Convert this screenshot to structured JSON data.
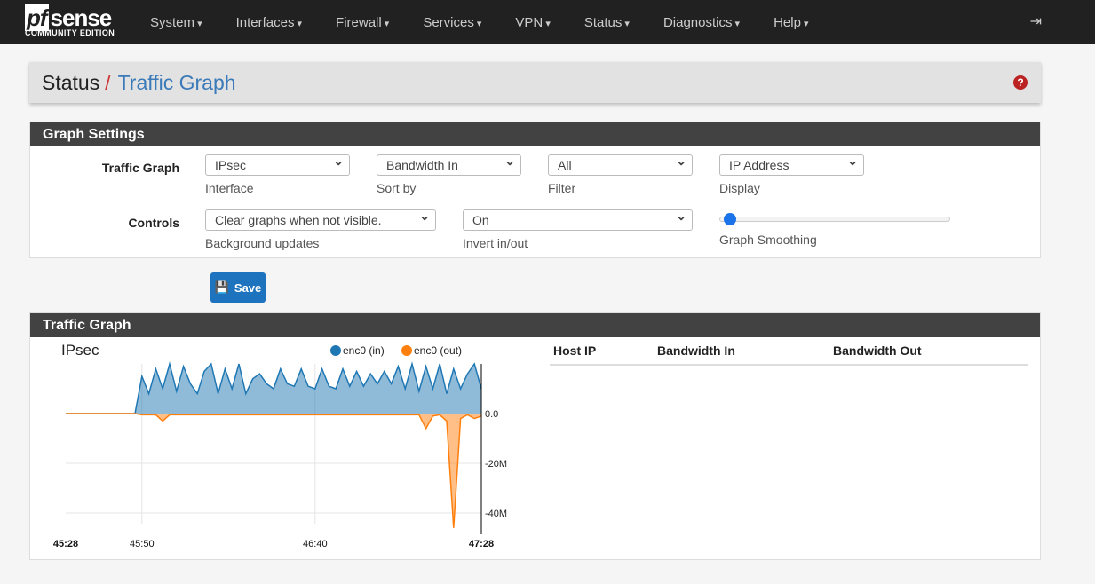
{
  "nav": {
    "logo_main": "pfsense",
    "logo_pf": "pf",
    "logo_rest": "sense",
    "logo_sub": "COMMUNITY EDITION",
    "items": [
      "System",
      "Interfaces",
      "Firewall",
      "Services",
      "VPN",
      "Status",
      "Diagnostics",
      "Help"
    ],
    "logout_icon": "sign-out-icon"
  },
  "breadcrumb": {
    "parent": "Status",
    "sep": "/",
    "current": "Traffic Graph",
    "help_icon": "question-circle-icon"
  },
  "settings": {
    "title": "Graph Settings",
    "row1": {
      "label": "Traffic Graph",
      "fields": [
        {
          "value": "IPsec",
          "hint": "Interface"
        },
        {
          "value": "Bandwidth In",
          "hint": "Sort by"
        },
        {
          "value": "All",
          "hint": "Filter"
        },
        {
          "value": "IP Address",
          "hint": "Display"
        }
      ]
    },
    "row2": {
      "label": "Controls",
      "fields": [
        {
          "value": "Clear graphs when not visible.",
          "hint": "Background updates"
        },
        {
          "value": "On",
          "hint": "Invert in/out"
        }
      ],
      "smoothing_hint": "Graph Smoothing",
      "smoothing_value": 0
    }
  },
  "save_label": "Save",
  "graph": {
    "title": "Traffic Graph",
    "table_headers": [
      "Host IP",
      "Bandwidth In",
      "Bandwidth Out"
    ]
  },
  "chart_data": {
    "type": "area",
    "title": "IPsec",
    "colors": {
      "in": "#1f77b4",
      "out": "#ff7f0e"
    },
    "xticks": [
      "45:28",
      "45:50",
      "46:40",
      "47:28"
    ],
    "xtick_seconds": [
      0,
      22,
      72,
      120
    ],
    "yticks": [
      "0.0",
      "-20M",
      "-40M"
    ],
    "ytick_values": [
      0,
      -20,
      -40
    ],
    "ylim": [
      -48,
      22
    ],
    "yunit": "M",
    "x_seconds": [
      0,
      2,
      4,
      6,
      8,
      10,
      12,
      14,
      16,
      18,
      20,
      22,
      24,
      26,
      28,
      30,
      32,
      34,
      36,
      38,
      40,
      42,
      44,
      46,
      48,
      50,
      52,
      54,
      56,
      58,
      60,
      62,
      64,
      66,
      68,
      70,
      72,
      74,
      76,
      78,
      80,
      82,
      84,
      86,
      88,
      90,
      92,
      94,
      96,
      98,
      100,
      102,
      104,
      106,
      108,
      110,
      112,
      114,
      116,
      118,
      120
    ],
    "series": [
      {
        "name": "enc0 (in)",
        "values": [
          0,
          0,
          0,
          0,
          0,
          0,
          0,
          0,
          0,
          0,
          0,
          15,
          8,
          18,
          10,
          20,
          9,
          19,
          12,
          8,
          17,
          20,
          8,
          18,
          10,
          20,
          8,
          14,
          16,
          12,
          10,
          18,
          12,
          11,
          18,
          11,
          10,
          18,
          11,
          10,
          18,
          11,
          17,
          11,
          16,
          12,
          17,
          12,
          19,
          10,
          20,
          9,
          19,
          10,
          20,
          8,
          18,
          10,
          16,
          20,
          10
        ]
      },
      {
        "name": "enc0 (out)",
        "values": [
          0,
          0,
          0,
          0,
          0,
          0,
          0,
          0,
          0,
          0,
          0,
          -0.5,
          -0.5,
          -0.5,
          -3,
          -0.5,
          -0.5,
          -0.5,
          -0.5,
          -0.5,
          -0.5,
          -0.5,
          -0.5,
          -0.5,
          -0.5,
          -0.5,
          -0.5,
          -0.5,
          -0.5,
          -0.5,
          -0.5,
          -0.5,
          -0.5,
          -0.5,
          -0.5,
          -0.5,
          -0.5,
          -0.5,
          -0.5,
          -0.5,
          -0.5,
          -0.5,
          -0.5,
          -0.5,
          -0.5,
          -0.5,
          -0.5,
          -0.5,
          -0.5,
          -0.5,
          -0.5,
          -0.5,
          -6,
          -1,
          -0.5,
          -3,
          -46,
          -2,
          -0.5,
          -2,
          -1
        ]
      }
    ]
  }
}
